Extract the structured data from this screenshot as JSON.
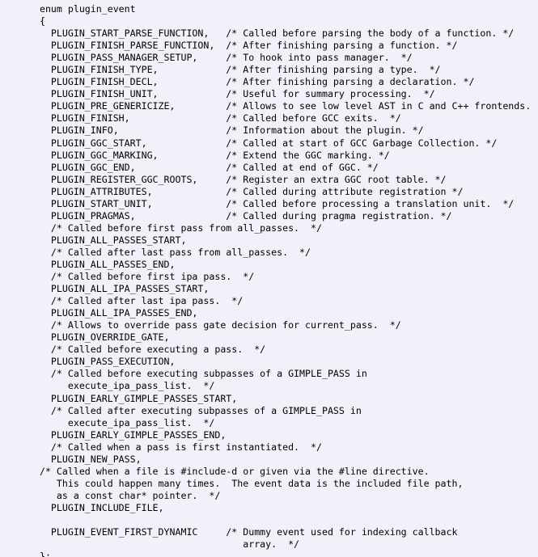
{
  "document": {
    "kind": "source-code-listing",
    "language": "C",
    "background_color": "#f1f1f9",
    "text_color": "#000000",
    "declaration": "enum plugin_event"
  },
  "code": {
    "lines": [
      "  enum plugin_event",
      "  {",
      "    PLUGIN_START_PARSE_FUNCTION,   /* Called before parsing the body of a function. */",
      "    PLUGIN_FINISH_PARSE_FUNCTION,  /* After finishing parsing a function. */",
      "    PLUGIN_PASS_MANAGER_SETUP,     /* To hook into pass manager.  */",
      "    PLUGIN_FINISH_TYPE,            /* After finishing parsing a type.  */",
      "    PLUGIN_FINISH_DECL,            /* After finishing parsing a declaration. */",
      "    PLUGIN_FINISH_UNIT,            /* Useful for summary processing.  */",
      "    PLUGIN_PRE_GENERICIZE,         /* Allows to see low level AST in C and C++ frontends.  */",
      "    PLUGIN_FINISH,                 /* Called before GCC exits.  */",
      "    PLUGIN_INFO,                   /* Information about the plugin. */",
      "    PLUGIN_GGC_START,              /* Called at start of GCC Garbage Collection. */",
      "    PLUGIN_GGC_MARKING,            /* Extend the GGC marking. */",
      "    PLUGIN_GGC_END,                /* Called at end of GGC. */",
      "    PLUGIN_REGISTER_GGC_ROOTS,     /* Register an extra GGC root table. */",
      "    PLUGIN_ATTRIBUTES,             /* Called during attribute registration */",
      "    PLUGIN_START_UNIT,             /* Called before processing a translation unit.  */",
      "    PLUGIN_PRAGMAS,                /* Called during pragma registration. */",
      "    /* Called before first pass from all_passes.  */",
      "    PLUGIN_ALL_PASSES_START,",
      "    /* Called after last pass from all_passes.  */",
      "    PLUGIN_ALL_PASSES_END,",
      "    /* Called before first ipa pass.  */",
      "    PLUGIN_ALL_IPA_PASSES_START,",
      "    /* Called after last ipa pass.  */",
      "    PLUGIN_ALL_IPA_PASSES_END,",
      "    /* Allows to override pass gate decision for current_pass.  */",
      "    PLUGIN_OVERRIDE_GATE,",
      "    /* Called before executing a pass.  */",
      "    PLUGIN_PASS_EXECUTION,",
      "    /* Called before executing subpasses of a GIMPLE_PASS in",
      "       execute_ipa_pass_list.  */",
      "    PLUGIN_EARLY_GIMPLE_PASSES_START,",
      "    /* Called after executing subpasses of a GIMPLE_PASS in",
      "       execute_ipa_pass_list.  */",
      "    PLUGIN_EARLY_GIMPLE_PASSES_END,",
      "    /* Called when a pass is first instantiated.  */",
      "    PLUGIN_NEW_PASS,",
      "  /* Called when a file is #include-d or given via the #line directive.",
      "     This could happen many times.  The event data is the included file path,",
      "     as a const char* pointer.  */",
      "    PLUGIN_INCLUDE_FILE,",
      "",
      "    PLUGIN_EVENT_FIRST_DYNAMIC     /* Dummy event used for indexing callback",
      "                                      array.  */",
      "  };"
    ]
  }
}
